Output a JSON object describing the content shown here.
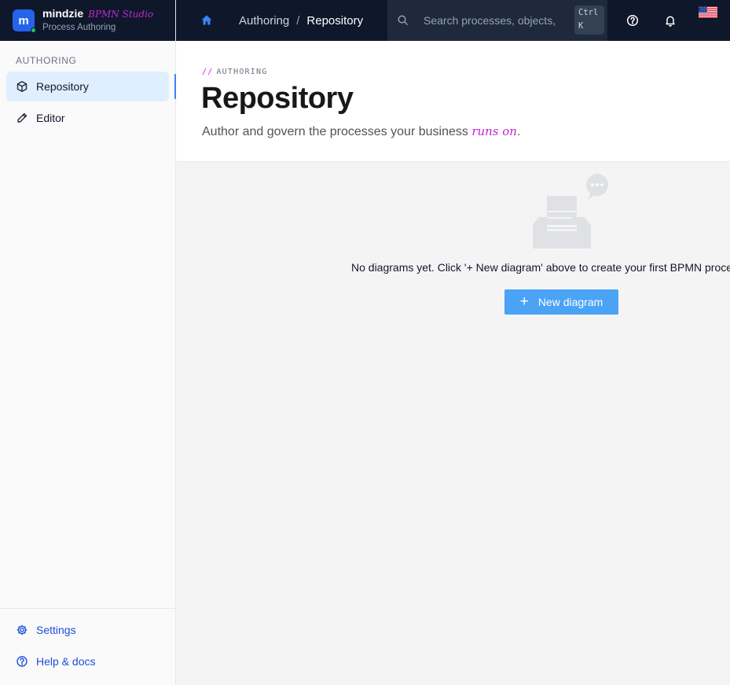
{
  "brand": {
    "logo_letter": "m",
    "name": "mindzie",
    "tag": "BPMN Studio",
    "subtitle": "Process Authoring"
  },
  "sidebar": {
    "section_label": "AUTHORING",
    "items": [
      {
        "label": "Repository",
        "icon": "cube-icon",
        "active": true
      },
      {
        "label": "Editor",
        "icon": "pencil-icon",
        "active": false
      }
    ],
    "footer_items": [
      {
        "label": "Settings",
        "icon": "gear-icon"
      },
      {
        "label": "Help & docs",
        "icon": "help-circle-icon"
      }
    ]
  },
  "topbar": {
    "breadcrumb": [
      "Authoring",
      "Repository"
    ],
    "breadcrumb_separator": "/",
    "search_placeholder": "Search processes, objects, p",
    "shortcut_line1": "Ctrl",
    "shortcut_line2": "K",
    "icons": [
      "home-icon",
      "search-icon",
      "help-icon",
      "bell-icon",
      "us-flag-icon"
    ]
  },
  "page": {
    "eyebrow_prefix": "//",
    "eyebrow": "AUTHORING",
    "title": "Repository",
    "subtitle_prefix": "Author and govern the processes your business ",
    "subtitle_emphasis": "runs on",
    "subtitle_suffix": "."
  },
  "empty_state": {
    "icon": "empty-inbox-icon",
    "message": "No diagrams yet. Click '+ New diagram' above to create your first BPMN process.",
    "button_label": "New diagram"
  },
  "colors": {
    "topbar_bg": "#0f172a",
    "brand_accent": "#c026d3",
    "active_nav_bg": "#e0efff",
    "primary_button": "#4aa3f5"
  }
}
